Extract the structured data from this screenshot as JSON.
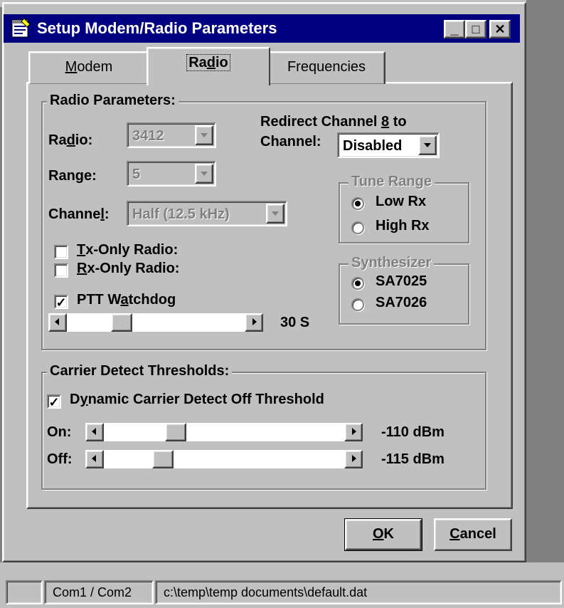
{
  "window": {
    "title": "Setup Modem/Radio Parameters",
    "controls": {
      "minimize": "_",
      "maximize": "□",
      "close": "✕"
    }
  },
  "tabs": [
    {
      "label": "Modem",
      "mnemonic": "M",
      "rest": "odem"
    },
    {
      "label": "Radio",
      "pre": "Ra",
      "mnemonic": "d",
      "post": "io",
      "selected": true
    },
    {
      "label": "Frequencies"
    }
  ],
  "radio_parameters": {
    "group_title": "Radio Parameters:",
    "radio": {
      "pre": "Ra",
      "mn": "d",
      "post": "io:",
      "value": "3412"
    },
    "range": {
      "pre": "Ran",
      "mn": "g",
      "post": "e:",
      "value": "5"
    },
    "channel": {
      "pre": "Channe",
      "mn": "l",
      "post": ":",
      "value": "Half (12.5 kHz)"
    },
    "redirect": {
      "line1_pre": "Redirect Channel ",
      "line1_mn": "8",
      "line1_post": " to",
      "line2": "Channel:",
      "value": "Disabled"
    },
    "tx_only": {
      "mn": "T",
      "rest": "x-Only Radio:",
      "checked": false
    },
    "rx_only": {
      "mn": "R",
      "rest": "x-Only Radio:",
      "checked": false
    },
    "ptt": {
      "pre": "PTT W",
      "mn": "a",
      "post": "tchdog",
      "checked": true
    },
    "ptt_slider": {
      "value_label": "30 S",
      "fraction": 0.28
    },
    "tune_range": {
      "title": "Tune Range",
      "options": [
        "Low Rx",
        "High Rx"
      ],
      "selected": "Low Rx"
    },
    "synthesizer": {
      "title": "Synthesizer",
      "options": [
        "SA7025",
        "SA7026"
      ],
      "selected": "SA7025"
    }
  },
  "carrier_detect": {
    "group_title": "Carrier Detect Thresholds:",
    "dynamic": {
      "pre": "D",
      "mn": "y",
      "post": "namic Carrier Detect Off Threshold",
      "checked": true
    },
    "on": {
      "label": "On:",
      "value_label": "-110 dBm",
      "fraction": 0.28
    },
    "off": {
      "label": "Off:",
      "value_label": "-115 dBm",
      "fraction": 0.22
    }
  },
  "buttons": {
    "ok": {
      "mn": "O",
      "rest": "K"
    },
    "cancel": {
      "mn": "C",
      "rest": "ancel"
    }
  },
  "status_bar": {
    "ports": "Com1 / Com2",
    "file": "c:\\temp\\temp documents\\default.dat"
  },
  "check_glyph": "✓"
}
